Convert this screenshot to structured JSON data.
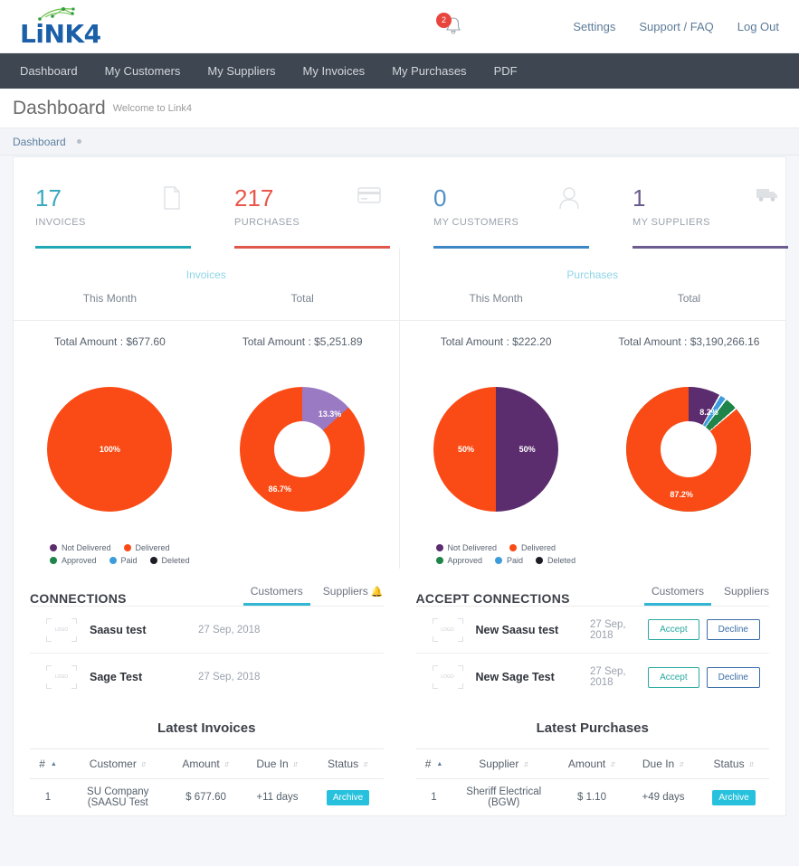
{
  "brand": {
    "logo_text": "LiNK4",
    "logo_icon": "network-dots-icon"
  },
  "header": {
    "notification_count": "2",
    "bell_icon": "bell-icon",
    "links": [
      {
        "label": "Settings"
      },
      {
        "label": "Support / FAQ"
      },
      {
        "label": "Log Out"
      }
    ]
  },
  "nav": {
    "items": [
      {
        "label": "Dashboard"
      },
      {
        "label": "My Customers"
      },
      {
        "label": "My Suppliers"
      },
      {
        "label": "My Invoices"
      },
      {
        "label": "My Purchases"
      },
      {
        "label": "PDF"
      }
    ]
  },
  "page": {
    "title": "Dashboard",
    "subtitle": "Welcome to Link4",
    "breadcrumb": "Dashboard"
  },
  "stats": [
    {
      "value": "17",
      "label": "INVOICES",
      "color": "#3aa9bd",
      "bar": "#21a8b5",
      "icon": "document-icon"
    },
    {
      "value": "217",
      "label": "PURCHASES",
      "color": "#e8574a",
      "bar": "#e0574c",
      "icon": "credit-card-icon"
    },
    {
      "value": "0",
      "label": "MY CUSTOMERS",
      "color": "#4f8fc4",
      "bar": "#3f87c4",
      "icon": "user-icon"
    },
    {
      "value": "1",
      "label": "MY SUPPLIERS",
      "color": "#6b5b8e",
      "bar": "#6b5b8e",
      "icon": "truck-icon"
    }
  ],
  "invoices_panel": {
    "section_label": "Invoices",
    "col_this_month": "This Month",
    "col_total": "Total",
    "amount_this_month": "Total Amount : $677.60",
    "amount_total": "Total Amount : $5,251.89"
  },
  "purchases_panel": {
    "section_label": "Purchases",
    "col_this_month": "This Month",
    "col_total": "Total",
    "amount_this_month": "Total Amount : $222.20",
    "amount_total": "Total Amount : $3,190,266.16"
  },
  "legend": {
    "items": [
      {
        "label": "Not Delivered",
        "color": "#5b2d6e"
      },
      {
        "label": "Delivered",
        "color": "#fa4b16"
      },
      {
        "label": "Approved",
        "color": "#1e8449"
      },
      {
        "label": "Paid",
        "color": "#3d9ddb"
      },
      {
        "label": "Deleted",
        "color": "#1c1c24"
      }
    ]
  },
  "chart_data": [
    {
      "type": "pie",
      "title": "Invoices This Month",
      "categories": [
        "Delivered"
      ],
      "values": [
        100
      ],
      "labels": [
        "100%"
      ],
      "colors": [
        "#fa4b16"
      ],
      "donut": false
    },
    {
      "type": "pie",
      "title": "Invoices Total",
      "categories": [
        "Delivered",
        "Not Delivered"
      ],
      "values": [
        86.7,
        13.3
      ],
      "labels": [
        "86.7%",
        "13.3%"
      ],
      "colors": [
        "#fa4b16",
        "#9b7ac4"
      ],
      "donut": true
    },
    {
      "type": "pie",
      "title": "Purchases This Month",
      "categories": [
        "Delivered",
        "Not Delivered"
      ],
      "values": [
        50,
        50
      ],
      "labels": [
        "50%",
        "50%"
      ],
      "colors": [
        "#fa4b16",
        "#5b2d6e"
      ],
      "donut": false
    },
    {
      "type": "pie",
      "title": "Purchases Total",
      "categories": [
        "Delivered",
        "Not Delivered",
        "Approved",
        "Paid"
      ],
      "values": [
        87.2,
        8.2,
        3.2,
        1.4
      ],
      "labels": [
        "87.2%",
        "8.2%",
        "",
        ""
      ],
      "colors": [
        "#fa4b16",
        "#5b2d6e",
        "#1e8449",
        "#3d9ddb"
      ],
      "donut": true
    }
  ],
  "connections": {
    "title": "CONNECTIONS",
    "tabs": [
      {
        "label": "Customers",
        "active": true
      },
      {
        "label": "Suppliers",
        "active": false,
        "alert_icon": "bell-alert-icon"
      }
    ],
    "rows": [
      {
        "logo_placeholder": "LOGO",
        "name": "Saasu test",
        "date": "27 Sep, 2018"
      },
      {
        "logo_placeholder": "LOGO",
        "name": "Sage Test",
        "date": "27 Sep, 2018"
      }
    ]
  },
  "accept_connections": {
    "title": "ACCEPT CONNECTIONS",
    "tabs": [
      {
        "label": "Customers",
        "active": true
      },
      {
        "label": "Suppliers",
        "active": false
      }
    ],
    "accept_label": "Accept",
    "decline_label": "Decline",
    "rows": [
      {
        "logo_placeholder": "LOGO",
        "name": "New Saasu test",
        "date": "27 Sep, 2018"
      },
      {
        "logo_placeholder": "LOGO",
        "name": "New Sage Test",
        "date": "27 Sep, 2018"
      }
    ]
  },
  "latest_invoices": {
    "title": "Latest Invoices",
    "columns": [
      "#",
      "Customer",
      "Amount",
      "Due In",
      "Status"
    ],
    "rows": [
      {
        "num": "1",
        "party": "SU Company (SAASU Test",
        "amount": "$ 677.60",
        "due": "+11 days",
        "status": "Archive"
      }
    ]
  },
  "latest_purchases": {
    "title": "Latest Purchases",
    "columns": [
      "#",
      "Supplier",
      "Amount",
      "Due In",
      "Status"
    ],
    "rows": [
      {
        "num": "1",
        "party": "Sheriff Electrical (BGW)",
        "amount": "$ 1.10",
        "due": "+49 days",
        "status": "Archive"
      }
    ]
  }
}
